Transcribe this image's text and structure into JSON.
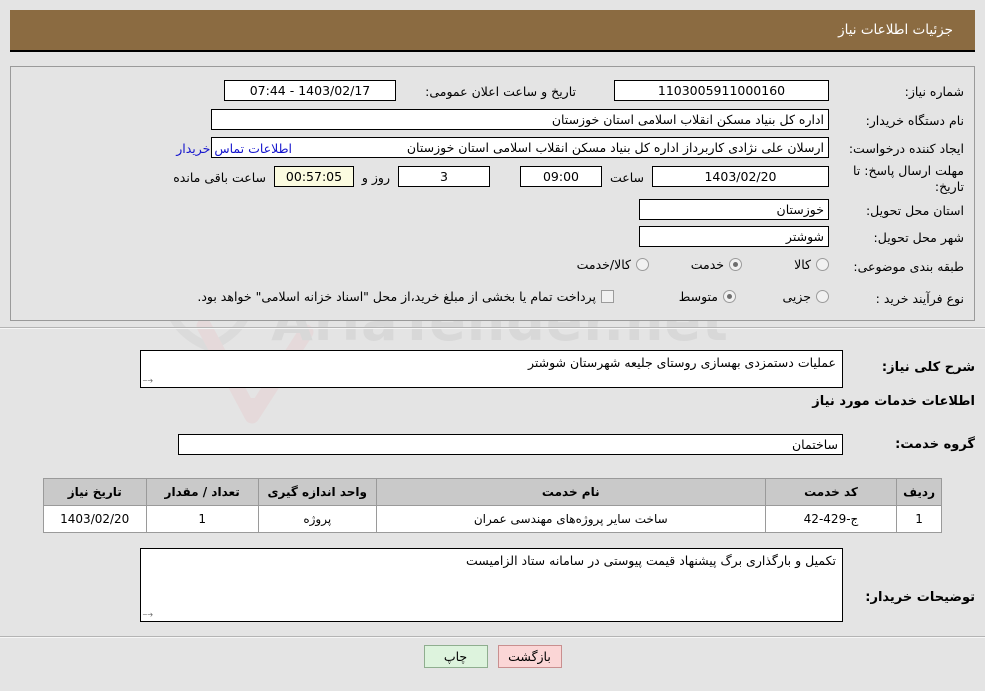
{
  "header": {
    "title": "جزئیات اطلاعات نیاز"
  },
  "colors": {
    "title_bar": "#8b6b41",
    "page_bg": "#e4e4e4",
    "link": "#1414cd",
    "table_header": "#c9c9c9",
    "countdown_bg": "#fbfbe0",
    "print_button": "#ddf3dd",
    "back_button": "#fbd6d6"
  },
  "form": {
    "need_number_label": "شماره نیاز:",
    "need_number_value": "1103005911000160",
    "announce_datetime_label": "تاریخ و ساعت اعلان عمومی:",
    "announce_datetime_value": "1403/02/17 - 07:44",
    "buyer_org_label": "نام دستگاه خریدار:",
    "buyer_org_value": "اداره کل بنیاد مسکن انقلاب اسلامی استان خوزستان",
    "creator_label": "ایجاد کننده درخواست:",
    "creator_value": "ارسلان علی نژادی کاربرداز اداره کل بنیاد مسکن انقلاب اسلامی استان خوزستان",
    "buyer_contact_link": "اطلاعات تماس خریدار",
    "deadline_label": "مهلت ارسال پاسخ: تا تاریخ:",
    "deadline_date": "1403/02/20",
    "deadline_hour_label": "ساعت",
    "deadline_hour": "09:00",
    "remaining_days": "3",
    "remaining_days_unit": "روز و",
    "remaining_clock": "00:57:05",
    "remaining_suffix": "ساعت باقی مانده",
    "province_label": "استان محل تحویل:",
    "province_value": "خوزستان",
    "city_label": "شهر محل تحویل:",
    "city_value": "شوشتر",
    "category_label": "طبقه بندی موضوعی:",
    "category_options": [
      {
        "label": "کالا",
        "selected": false
      },
      {
        "label": "خدمت",
        "selected": true
      },
      {
        "label": "کالا/خدمت",
        "selected": false
      }
    ],
    "process_label": "نوع فرآیند خرید :",
    "process_options": [
      {
        "label": "جزیی",
        "selected": false
      },
      {
        "label": "متوسط",
        "selected": true
      }
    ],
    "treasury_checkbox_label": "پرداخت تمام یا بخشی از مبلغ خرید،از محل \"اسناد خزانه اسلامی\" خواهد بود.",
    "treasury_checked": false
  },
  "description": {
    "label": "شرح کلی نیاز:",
    "value": "عملیات دستمزدی بهسازی روستای جلیعه شهرستان شوشتر"
  },
  "services_section": {
    "heading": "اطلاعات خدمات مورد نیاز",
    "group_label": "گروه خدمت:",
    "group_value": "ساختمان"
  },
  "table": {
    "columns": [
      "ردیف",
      "کد خدمت",
      "نام خدمت",
      "واحد اندازه گیری",
      "تعداد / مقدار",
      "تاریخ نیاز"
    ],
    "rows": [
      {
        "row": "1",
        "code": "ج-429-42",
        "name": "ساخت سایر پروژه‌های مهندسی عمران",
        "unit": "پروژه",
        "quantity": "1",
        "date": "1403/02/20"
      }
    ]
  },
  "buyer_notes": {
    "label": "توضیحات خریدار:",
    "value": "تکمیل و بارگذاری برگ پیشنهاد قیمت پیوستی در سامانه ستاد الزامیست"
  },
  "footer": {
    "print_label": "چاپ",
    "back_label": "بازگشت"
  },
  "watermark": {
    "text": "AriaTender.net"
  }
}
